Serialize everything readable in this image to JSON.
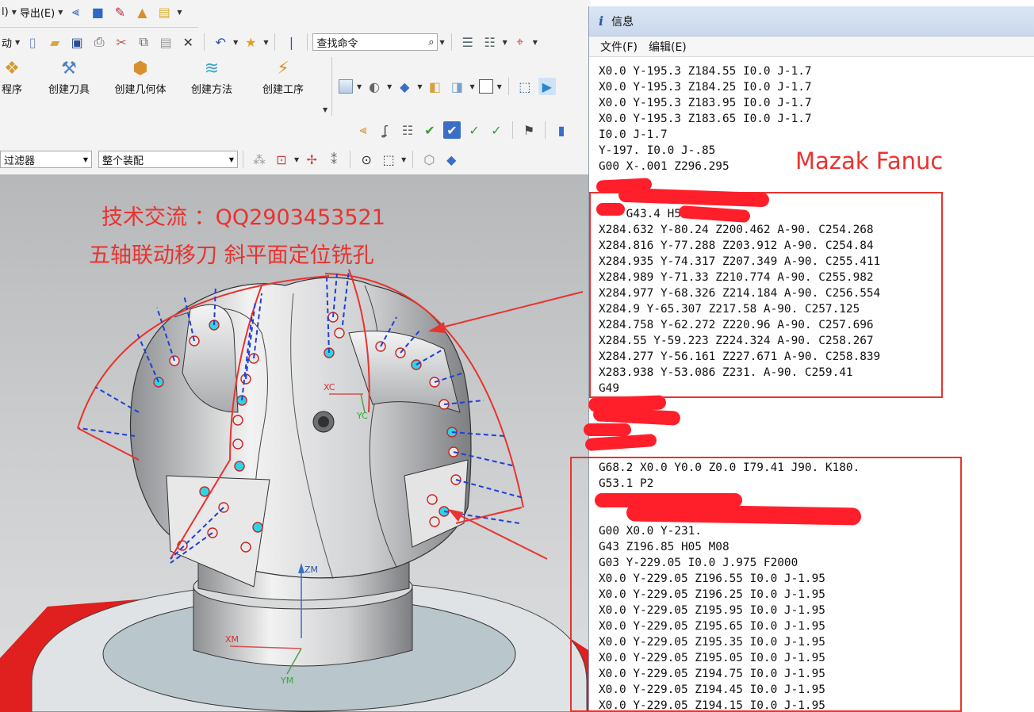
{
  "toolbar": {
    "menu_partial": "l)",
    "export_label": "导出(E)",
    "move_partial": "动",
    "search_placeholder": "查找命令",
    "buttons": [
      {
        "label": "程序"
      },
      {
        "label": "创建刀具"
      },
      {
        "label": "创建几何体"
      },
      {
        "label": "创建方法"
      },
      {
        "label": "创建工序"
      }
    ],
    "filter_select": "过滤器",
    "assembly_select": "整个装配"
  },
  "annotations": {
    "line1": "技术交流 ：QQ2903453521",
    "line2": "五轴联动移刀 斜平面定位铣孔",
    "controller": "Mazak Fanuc"
  },
  "axes": {
    "xc": "XC",
    "yc": "YC",
    "zm": "ZM",
    "xm": "XM",
    "ym": "YM"
  },
  "info_window": {
    "title_icon": "i",
    "title": "信息",
    "menu": [
      "文件(F)",
      "编辑(E)"
    ],
    "block_top": [
      "X0.0 Y-195.3 Z184.55 I0.0 J-1.7",
      "X0.0 Y-195.3 Z184.25 I0.0 J-1.7",
      "X0.0 Y-195.3 Z183.95 I0.0 J-1.7",
      "X0.0 Y-195.3 Z183.65 I0.0 J-1.7",
      "I0.0 J-1.7",
      "Y-197. I0.0 J-.85",
      "G00 X-.001 Z296.295"
    ],
    "block_mid_head": "    G43.4 H5.",
    "block_mid": [
      "X284.632 Y-80.24 Z200.462 A-90. C254.268",
      "X284.816 Y-77.288 Z203.912 A-90. C254.84",
      "X284.935 Y-74.317 Z207.349 A-90. C255.411",
      "X284.989 Y-71.33 Z210.774 A-90. C255.982",
      "X284.977 Y-68.326 Z214.184 A-90. C256.554",
      "X284.9 Y-65.307 Z217.58 A-90. C257.125",
      "X284.758 Y-62.272 Z220.96 A-90. C257.696",
      "X284.55 Y-59.223 Z224.324 A-90. C258.267",
      "X284.277 Y-56.161 Z227.671 A-90. C258.839",
      "X283.938 Y-53.086 Z231. A-90. C259.41",
      "G49"
    ],
    "block_bottom_head": [
      "G68.2 X0.0 Y0.0 Z0.0 I79.41 J90. K180.",
      "G53.1 P2"
    ],
    "block_bottom": [
      "G00 X0.0 Y-231.",
      "G43 Z196.85 H05 M08",
      "G03 Y-229.05 I0.0 J.975 F2000",
      "X0.0 Y-229.05 Z196.55 I0.0 J-1.95",
      "X0.0 Y-229.05 Z196.25 I0.0 J-1.95",
      "X0.0 Y-229.05 Z195.95 I0.0 J-1.95",
      "X0.0 Y-229.05 Z195.65 I0.0 J-1.95",
      "X0.0 Y-229.05 Z195.35 I0.0 J-1.95",
      "X0.0 Y-229.05 Z195.05 I0.0 J-1.95",
      "X0.0 Y-229.05 Z194.75 I0.0 J-1.95",
      "X0.0 Y-229.05 Z194.45 I0.0 J-1.95",
      "X0.0 Y-229.05 Z194.15 I0.0 J-1.95"
    ]
  },
  "colors": {
    "annotation_red": "#e8332f",
    "toolpath_blue": "#1f3fd6",
    "titlebar": "#c8d8ec"
  }
}
